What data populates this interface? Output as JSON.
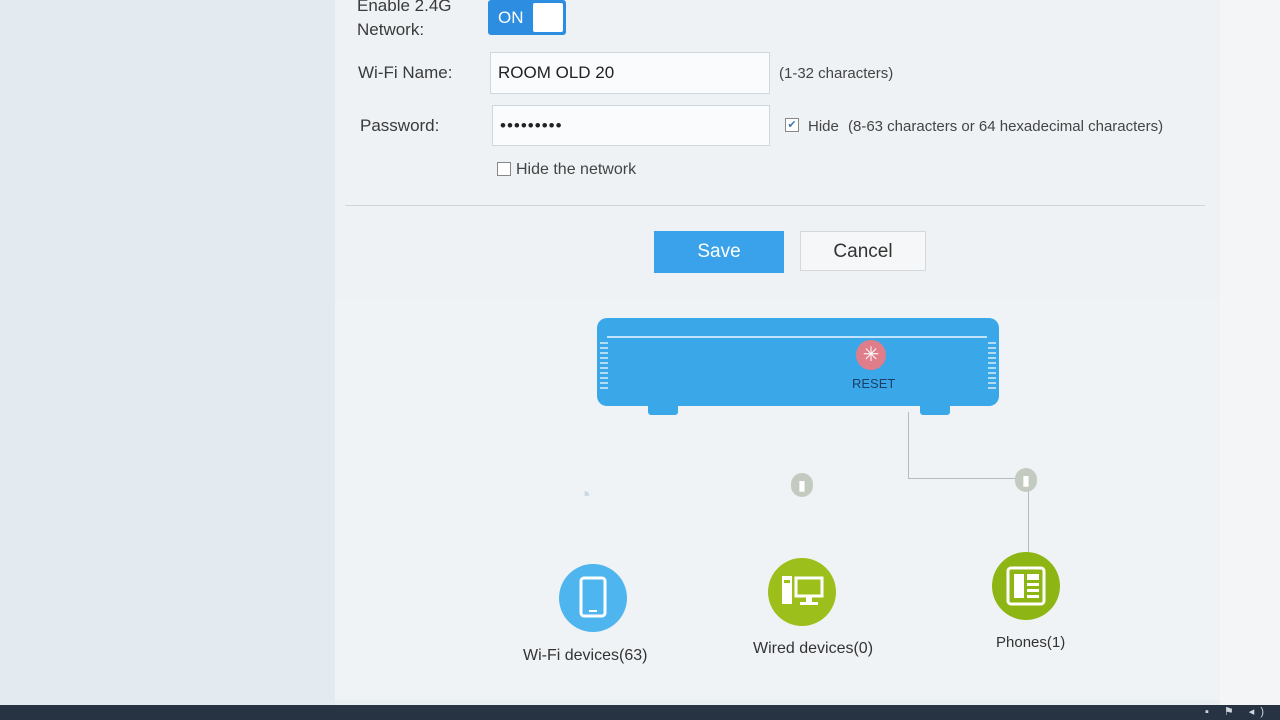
{
  "form": {
    "enable_label_line1": "Enable 2.4G",
    "enable_label_line2": "Network:",
    "toggle_label": "ON",
    "wifi_name_label": "Wi-Fi Name:",
    "wifi_name_value": "ROOM OLD 20",
    "wifi_name_hint": "(1-32 characters)",
    "password_label": "Password:",
    "password_value": "•••••••••",
    "hide_password_label": "Hide",
    "hide_password_checked": true,
    "password_hint": "(8-63 characters or 64 hexadecimal characters)",
    "hide_network_label": "Hide the network",
    "hide_network_checked": false,
    "save_label": "Save",
    "cancel_label": "Cancel"
  },
  "topology": {
    "reset_label": "RESET",
    "devices": [
      {
        "label": "Wi-Fi devices(63)",
        "icon": "tablet-icon",
        "color": "#4fb5ee"
      },
      {
        "label": "Wired devices(0)",
        "icon": "computer-icon",
        "color": "#9cbf1c"
      },
      {
        "label": "Phones(1)",
        "icon": "phone-icon",
        "color": "#8db614"
      }
    ]
  },
  "colors": {
    "accent": "#2d8de0",
    "router": "#3aa8e8",
    "wired": "#9cbf1c"
  }
}
